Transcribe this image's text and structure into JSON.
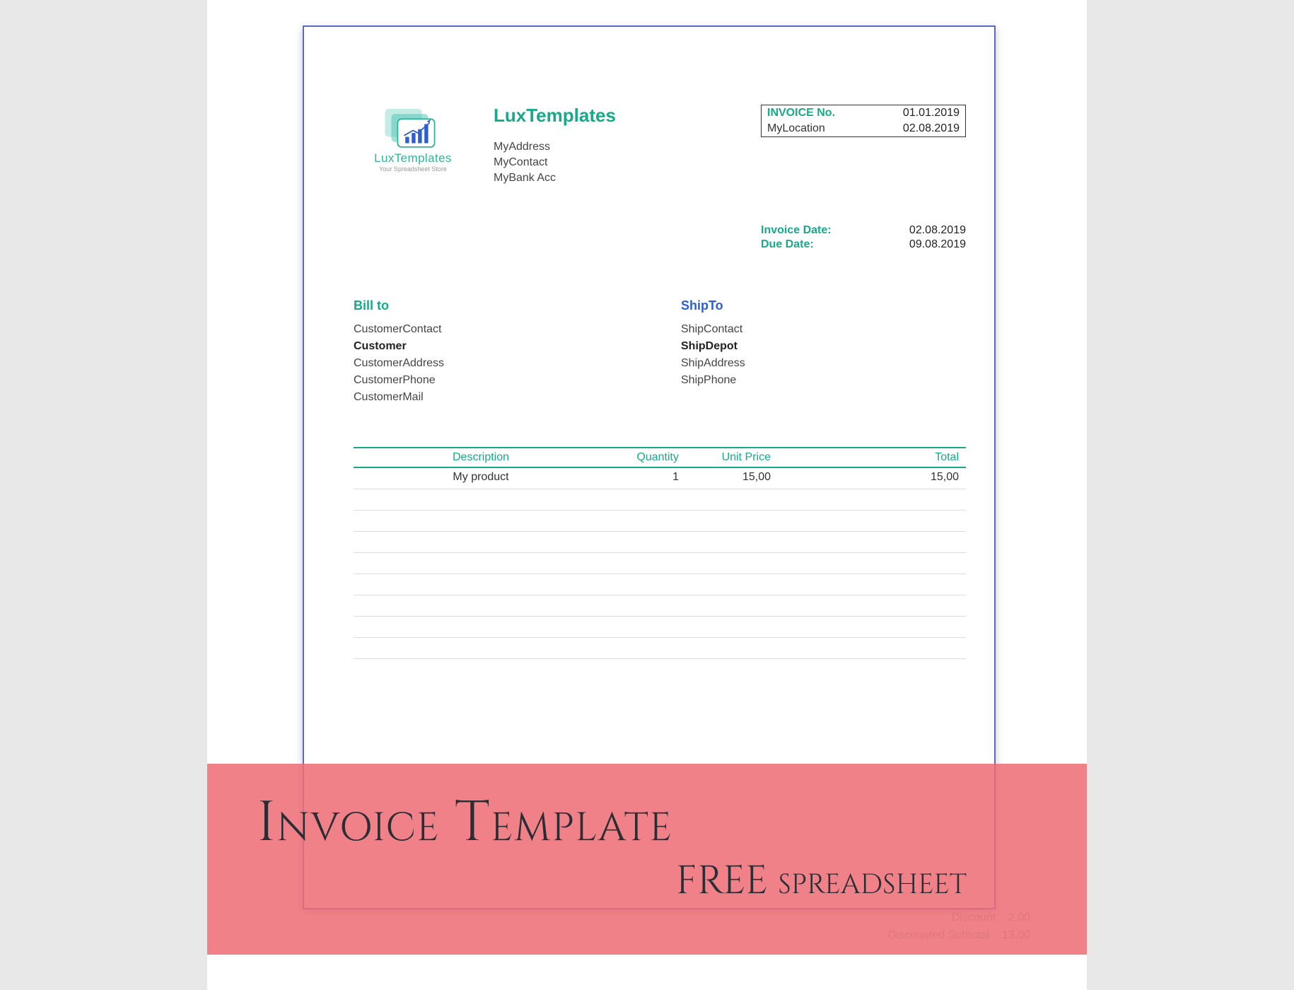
{
  "company": {
    "name": "LuxTemplates",
    "logo_text": "LuxTemplates",
    "logo_tagline": "Your Spreadsheet Store",
    "address": "MyAddress",
    "contact": "MyContact",
    "bank": "MyBank Acc"
  },
  "invoice_box": {
    "row1_label": "INVOICE No.",
    "row1_value": "01.01.2019",
    "row2_label": "MyLocation",
    "row2_value": "02.08.2019"
  },
  "dates": {
    "invoice_date_label": "Invoice Date:",
    "invoice_date_value": "02.08.2019",
    "due_date_label": "Due Date:",
    "due_date_value": "09.08.2019"
  },
  "bill_to": {
    "heading": "Bill to",
    "contact": "CustomerContact",
    "name": "Customer",
    "address": "CustomerAddress",
    "phone": "CustomerPhone",
    "mail": "CustomerMail"
  },
  "ship_to": {
    "heading": "ShipTo",
    "contact": "ShipContact",
    "name": "ShipDepot",
    "address": "ShipAddress",
    "phone": "ShipPhone"
  },
  "items": {
    "headers": {
      "description": "Description",
      "quantity": "Quantity",
      "unit_price": "Unit Price",
      "total": "Total"
    },
    "rows": [
      {
        "description": "My product",
        "quantity": "1",
        "unit_price": "15,00",
        "total": "15,00"
      }
    ],
    "empty_rows": 8
  },
  "banner": {
    "title": "Invoice Template",
    "subtitle": "FREE spreadsheet"
  },
  "ghost": {
    "line1_label": "Discount",
    "line1_value": "2,00",
    "line2_label": "Discounted Subtotal",
    "line2_value": "13,00"
  },
  "colors": {
    "teal": "#17A98A",
    "blue": "#2D5FCE",
    "border": "#5A6BC7",
    "banner": "#ED6C76"
  }
}
